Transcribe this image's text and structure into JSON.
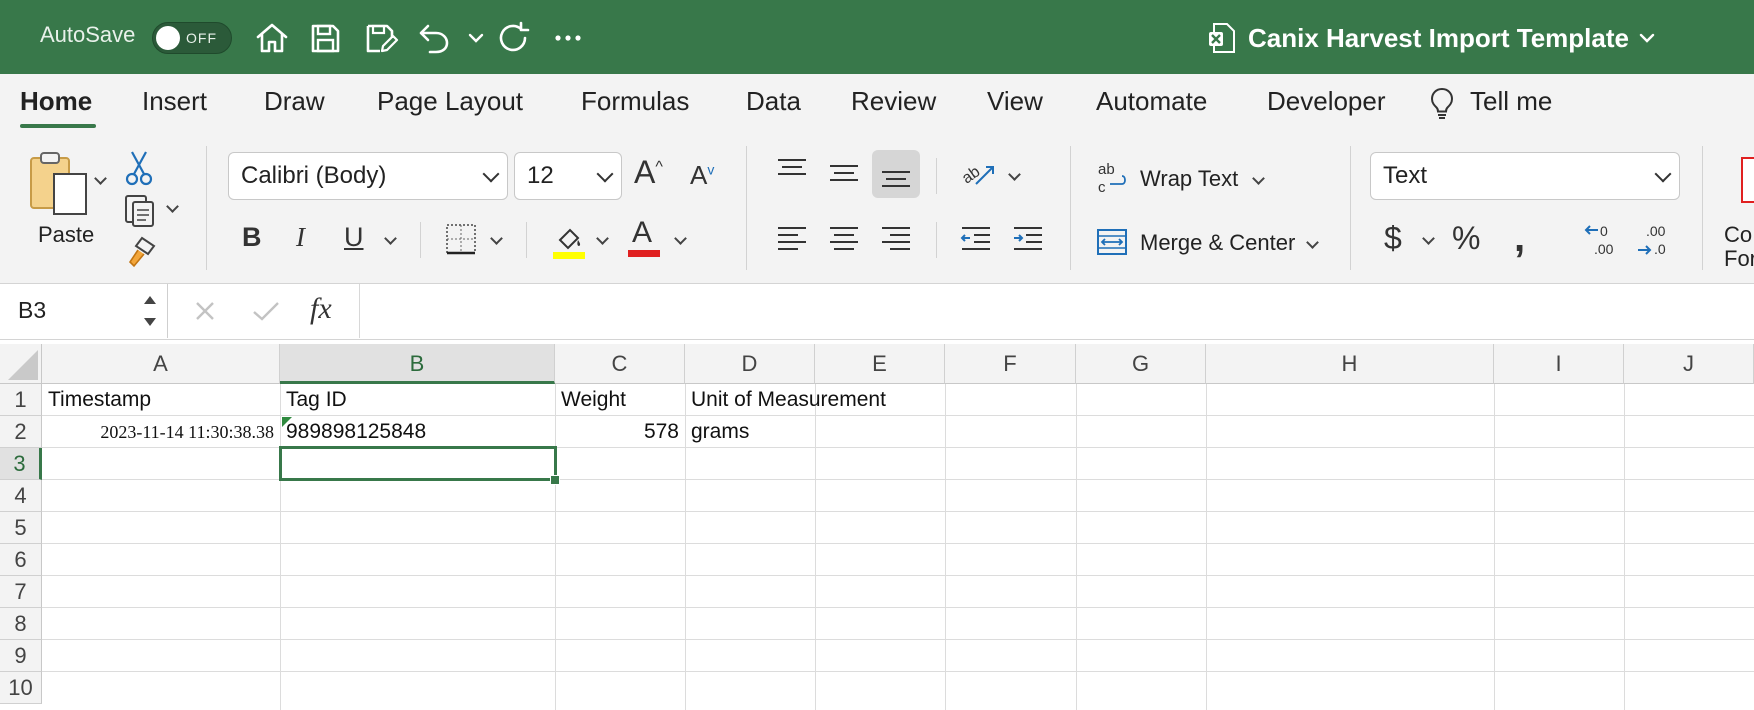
{
  "titlebar": {
    "autosave_label": "AutoSave",
    "autosave_state": "OFF",
    "document_title": "Canix Harvest Import Template",
    "icons": [
      "home-icon",
      "save-icon",
      "save-as-icon",
      "undo-icon",
      "redo-icon",
      "more-icon"
    ]
  },
  "ribbon_tabs": [
    "Home",
    "Insert",
    "Draw",
    "Page Layout",
    "Formulas",
    "Data",
    "Review",
    "View",
    "Automate",
    "Developer",
    "Tell me"
  ],
  "active_tab": "Home",
  "ribbon": {
    "paste_label": "Paste",
    "font_name": "Calibri (Body)",
    "font_size": "12",
    "wrap_text_label": "Wrap Text",
    "merge_center_label": "Merge & Center",
    "number_format": "Text",
    "conditional_formatting_partial": "Co",
    "conditional_formatting_partial2": "For",
    "bold_label": "B",
    "italic_label": "I",
    "underline_label": "U",
    "font_color_label": "A",
    "highlight_color": "#ffff00",
    "font_color": "#e02020"
  },
  "formula_bar": {
    "name_box": "B3",
    "fx_label": "fx",
    "value": ""
  },
  "grid": {
    "columns": [
      "A",
      "B",
      "C",
      "D",
      "E",
      "F",
      "G",
      "H",
      "I",
      "J"
    ],
    "rows": [
      "1",
      "2",
      "3",
      "4",
      "5",
      "6",
      "7",
      "8",
      "9",
      "10"
    ],
    "selected_cell": "B3",
    "cells": {
      "A1": "Timestamp",
      "B1": "Tag ID",
      "C1": "Weight",
      "D1": "Unit of Measurement",
      "A2": "2023-11-14 11:30:38.38",
      "B2": "989898125848",
      "C2": "578",
      "D2": "grams"
    }
  },
  "colors": {
    "title_bar": "#38784a",
    "accent": "#38784a",
    "ribbon_bg": "#f3f3f3"
  }
}
